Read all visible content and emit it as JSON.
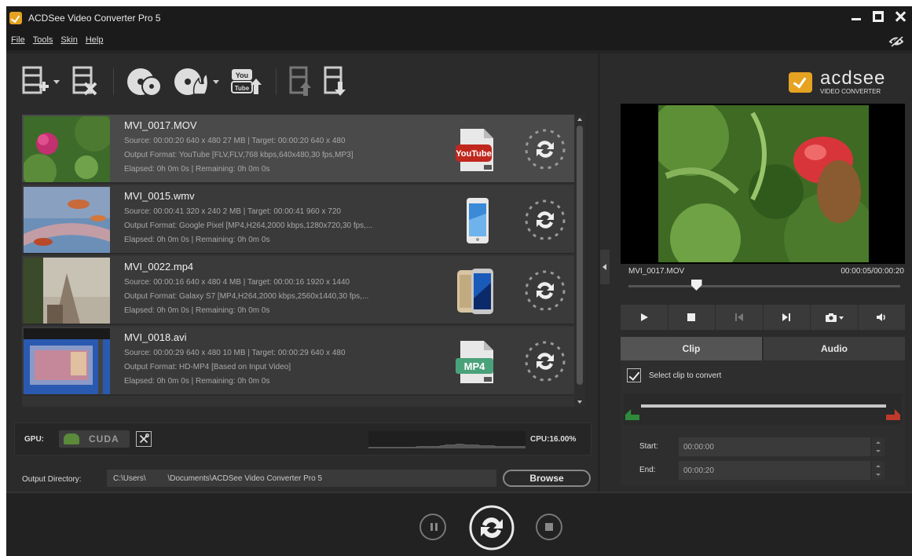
{
  "window": {
    "title": "ACDSee Video Converter Pro 5"
  },
  "menu": {
    "items": [
      "File",
      "Tools",
      "Skin",
      "Help"
    ]
  },
  "files": [
    {
      "name": "MVI_0017.MOV",
      "source": "Source: 00:00:20 640 x 480 27 MB | Target: 00:00:20 640 x 480",
      "output": "Output Format: YouTube [FLV,FLV,768 kbps,640x480,30 fps,MP3]",
      "elapsed": "Elapsed: 0h 0m 0s | Remaining: 0h 0m 0s",
      "format_icon": "youtube-format-icon"
    },
    {
      "name": "MVI_0015.wmv",
      "source": "Source: 00:00:41 320 x 240 2 MB | Target: 00:00:41 960 x 720",
      "output": "Output Format: Google Pixel [MP4,H264,2000 kbps,1280x720,30 fps,...",
      "elapsed": "Elapsed: 0h 0m 0s | Remaining: 0h 0m 0s",
      "format_icon": "google-pixel-phone-icon"
    },
    {
      "name": "MVI_0022.mp4",
      "source": "Source: 00:00:16 640 x 480 4 MB | Target: 00:00:16 1920 x 1440",
      "output": "Output Format: Galaxy S7 [MP4,H264,2000 kbps,2560x1440,30 fps,...",
      "elapsed": "Elapsed: 0h 0m 0s | Remaining: 0h 0m 0s",
      "format_icon": "galaxy-s7-phone-icon"
    },
    {
      "name": "MVI_0018.avi",
      "source": "Source: 00:00:29 640 x 480 10 MB | Target: 00:00:29 640 x 480",
      "output": "Output Format: HD-MP4 [Based on Input Video]",
      "elapsed": "Elapsed: 0h 0m 0s | Remaining: 0h 0m 0s",
      "format_icon": "mp4-file-icon"
    }
  ],
  "gpu": {
    "label": "GPU:",
    "cuda": "CUDA"
  },
  "cpu": {
    "label": "CPU:16.00%"
  },
  "output_dir": {
    "label": "Output Directory:",
    "value": "C:\\Users\\          \\Documents\\ACDSee Video Converter Pro 5",
    "browse": "Browse"
  },
  "brand": {
    "name": "acdsee",
    "sub": "VIDEO CONVERTER"
  },
  "preview": {
    "clip_name": "MVI_0017.MOV",
    "time": "00:00:05/00:00:20",
    "progress": 0.25
  },
  "tabs": {
    "clip": "Clip",
    "audio": "Audio"
  },
  "clip": {
    "select_label": "Select clip to convert",
    "start_label": "Start:",
    "start_value": "00:00:00",
    "end_label": "End:",
    "end_value": "00:00:20"
  },
  "colors": {
    "accent": "#e5a321",
    "trim_start": "#2e8b3a",
    "trim_end": "#c0392b"
  }
}
